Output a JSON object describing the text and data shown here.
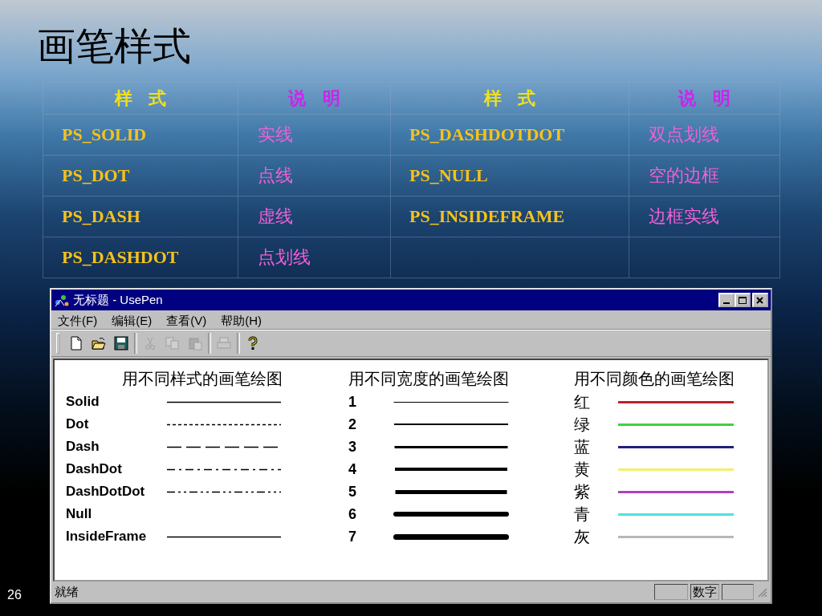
{
  "slide": {
    "title": "画笔样式",
    "page_number": "26"
  },
  "table": {
    "columns": [
      "样 式",
      "说 明",
      "样 式",
      "说 明"
    ],
    "rows": [
      [
        "PS_SOLID",
        "实线",
        "PS_DASHDOTDOT",
        "双点划线"
      ],
      [
        "PS_DOT",
        "点线",
        "PS_NULL",
        "空的边框"
      ],
      [
        "PS_DASH",
        "虚线",
        "PS_INSIDEFRAME",
        "边框实线"
      ],
      [
        "PS_DASHDOT",
        "点划线"
      ]
    ]
  },
  "window": {
    "title": "无标题 - UsePen",
    "menu": [
      "文件(F)",
      "编辑(E)",
      "查看(V)",
      "帮助(H)"
    ],
    "toolbar": [
      {
        "kind": "new",
        "disabled": false
      },
      {
        "kind": "open",
        "disabled": false
      },
      {
        "kind": "save",
        "disabled": false
      },
      {
        "kind": "separator"
      },
      {
        "kind": "cut",
        "disabled": true
      },
      {
        "kind": "copy",
        "disabled": true
      },
      {
        "kind": "paste",
        "disabled": true
      },
      {
        "kind": "separator"
      },
      {
        "kind": "print",
        "disabled": true
      },
      {
        "kind": "separator"
      },
      {
        "kind": "help",
        "disabled": false
      }
    ],
    "style_panel": {
      "heading": "用不同样式的画笔绘图",
      "items": [
        {
          "label": "Solid",
          "kind": "solid"
        },
        {
          "label": "Dot",
          "kind": "dot"
        },
        {
          "label": "Dash",
          "kind": "dash"
        },
        {
          "label": "DashDot",
          "kind": "dashdot"
        },
        {
          "label": "DashDotDot",
          "kind": "dashdotdot"
        },
        {
          "label": "Null",
          "kind": "null"
        },
        {
          "label": "InsideFrame",
          "kind": "insideframe"
        }
      ]
    },
    "width_panel": {
      "heading": "用不同宽度的画笔绘图",
      "items": [
        {
          "label": "1"
        },
        {
          "label": "2"
        },
        {
          "label": "3"
        },
        {
          "label": "4"
        },
        {
          "label": "5"
        },
        {
          "label": "6"
        },
        {
          "label": "7"
        }
      ]
    },
    "color_panel": {
      "heading": "用不同颜色的画笔绘图",
      "items": [
        {
          "label": "红",
          "color": "#c0202a"
        },
        {
          "label": "绿",
          "color": "#40d040"
        },
        {
          "label": "蓝",
          "color": "#20207a"
        },
        {
          "label": "黄",
          "color": "#f0f070"
        },
        {
          "label": "紫",
          "color": "#b040c0"
        },
        {
          "label": "青",
          "color": "#50e0e0"
        },
        {
          "label": "灰",
          "color": "#b8b8b8"
        }
      ]
    },
    "status_bar": {
      "message": "就绪",
      "indicator": "数字"
    }
  }
}
